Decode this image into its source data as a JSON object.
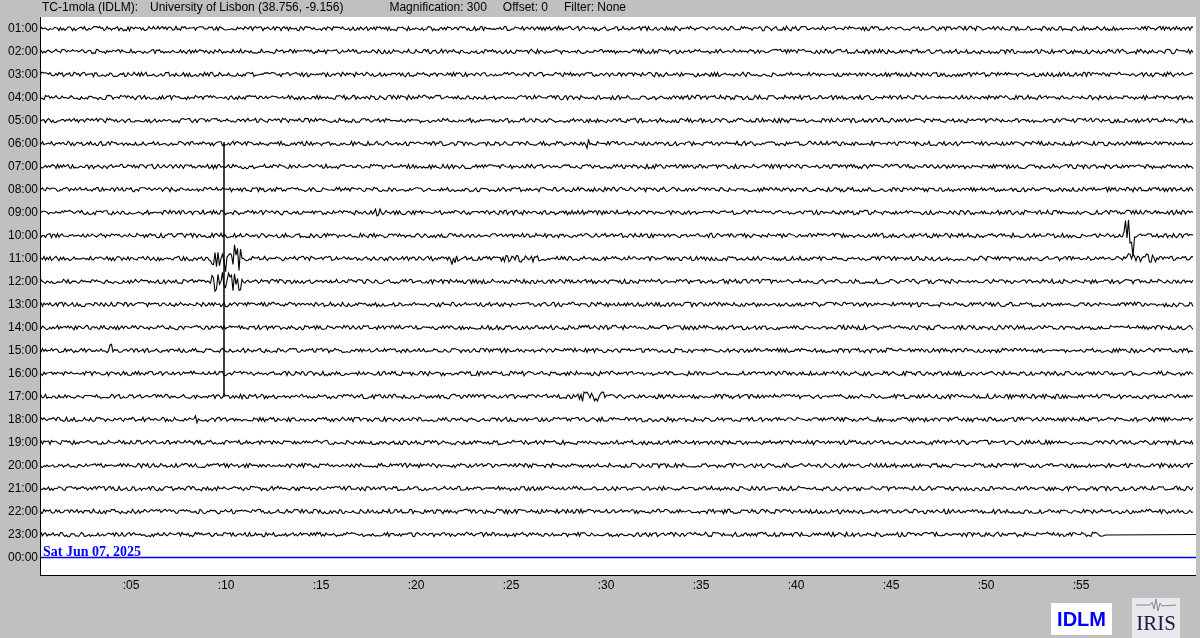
{
  "header": {
    "station": "TC-1mola (IDLM):",
    "location": "University of Lisbon (38.756, -9.156)",
    "magnification": "Magnification: 300",
    "offset": "Offset: 0",
    "filter": "Filter: None"
  },
  "rows": [
    {
      "label": "01:00",
      "kind": "trace"
    },
    {
      "label": "02:00",
      "kind": "trace"
    },
    {
      "label": "03:00",
      "kind": "trace"
    },
    {
      "label": "04:00",
      "kind": "trace"
    },
    {
      "label": "05:00",
      "kind": "trace"
    },
    {
      "label": "06:00",
      "kind": "trace"
    },
    {
      "label": "07:00",
      "kind": "trace"
    },
    {
      "label": "08:00",
      "kind": "trace"
    },
    {
      "label": "09:00",
      "kind": "trace"
    },
    {
      "label": "10:00",
      "kind": "trace"
    },
    {
      "label": "11:00",
      "kind": "trace"
    },
    {
      "label": "12:00",
      "kind": "trace"
    },
    {
      "label": "13:00",
      "kind": "trace"
    },
    {
      "label": "14:00",
      "kind": "trace"
    },
    {
      "label": "15:00",
      "kind": "trace"
    },
    {
      "label": "16:00",
      "kind": "trace"
    },
    {
      "label": "17:00",
      "kind": "trace"
    },
    {
      "label": "18:00",
      "kind": "trace"
    },
    {
      "label": "19:00",
      "kind": "trace"
    },
    {
      "label": "20:00",
      "kind": "trace"
    },
    {
      "label": "21:00",
      "kind": "trace"
    },
    {
      "label": "22:00",
      "kind": "trace"
    },
    {
      "label": "23:00",
      "kind": "partial"
    },
    {
      "label": "00:00",
      "kind": "current",
      "date": "Sat Jun 07, 2025"
    }
  ],
  "x_ticks": [
    ":05",
    ":10",
    ":15",
    ":20",
    ":25",
    ":30",
    ":35",
    ":40",
    ":45",
    ":50",
    ":55"
  ],
  "logos": {
    "idlm": "IDLM",
    "iris": "IRIS"
  }
}
